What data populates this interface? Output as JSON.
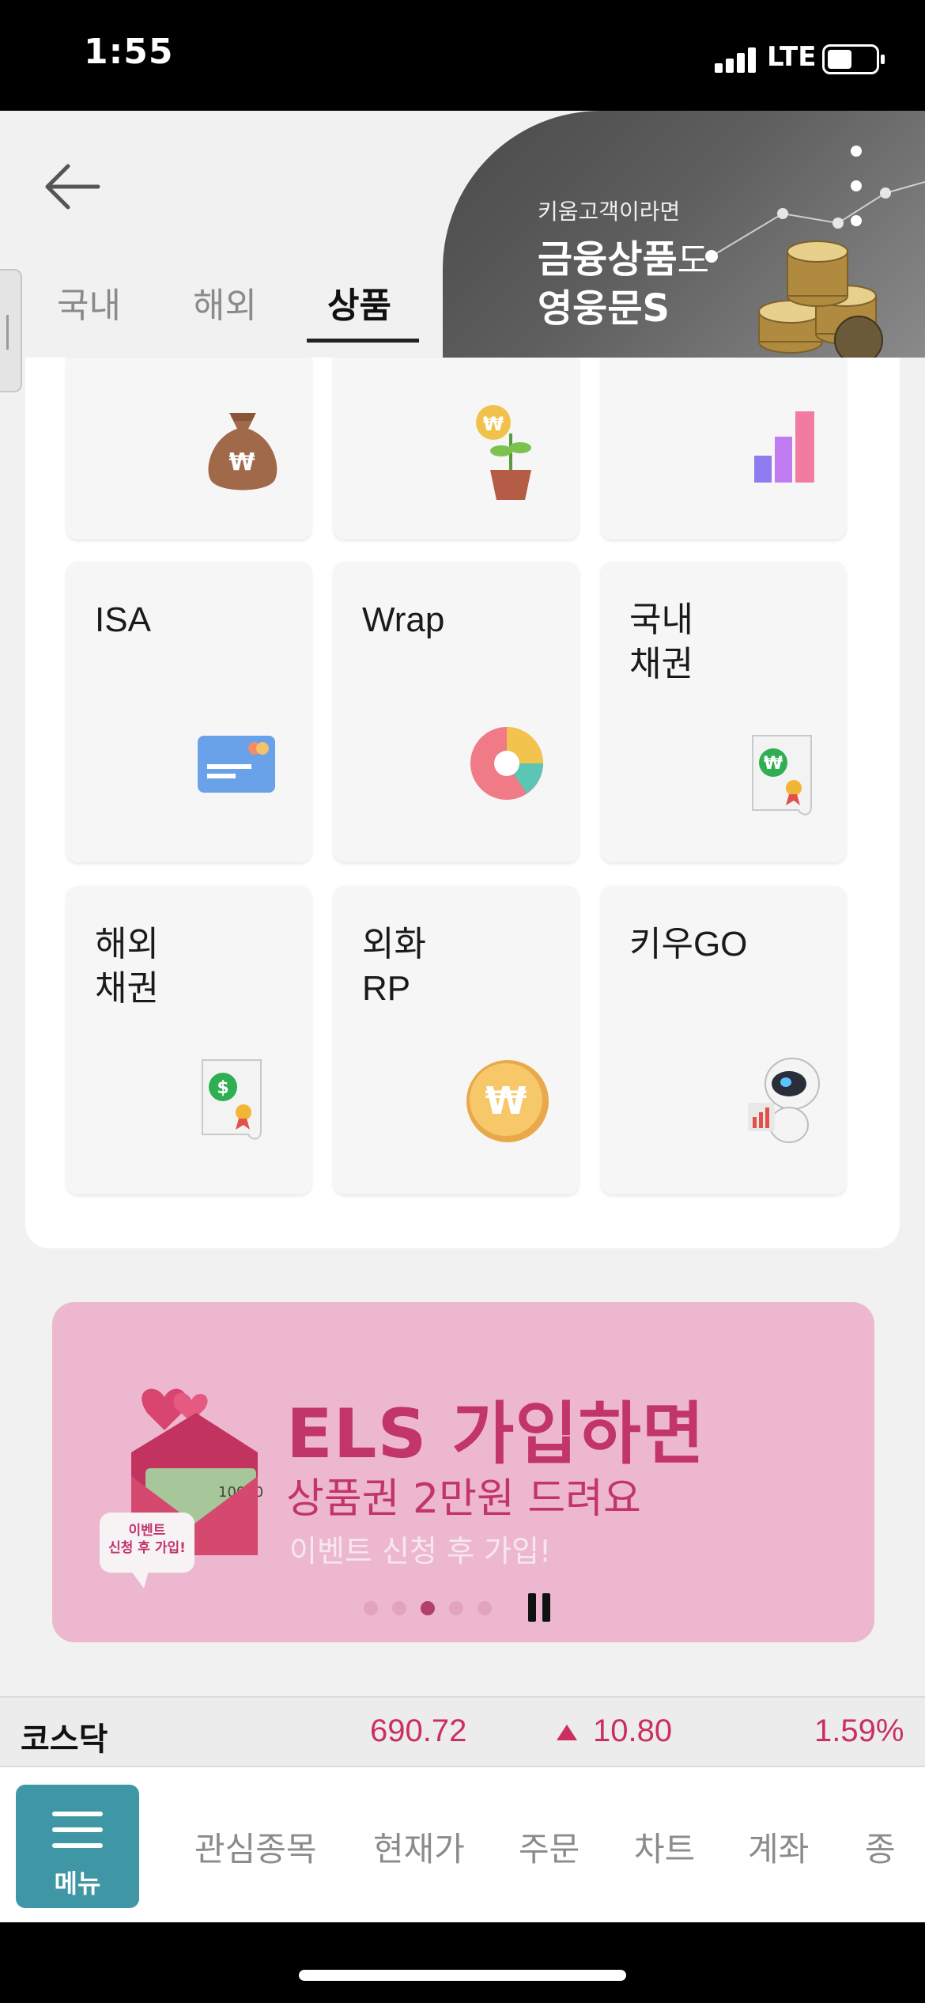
{
  "status": {
    "time": "1:55",
    "network": "LTE"
  },
  "tabs": [
    "국내",
    "해외",
    "상품"
  ],
  "hero": {
    "small": "키움고객이라면",
    "line1_bold": "금융상품",
    "line1_thin": "도",
    "line2": "영웅문S"
  },
  "tiles_row2": [
    {
      "label": "ISA",
      "icon": "credit-card-icon"
    },
    {
      "label": "Wrap",
      "icon": "pie-chart-icon"
    },
    {
      "label": "국내\n채권",
      "icon": "won-certificate-icon"
    }
  ],
  "tiles_row3": [
    {
      "label": "해외\n채권",
      "icon": "dollar-certificate-icon"
    },
    {
      "label": "외화\nRP",
      "icon": "won-coin-icon"
    },
    {
      "label": "키우GO",
      "icon": "robot-icon"
    }
  ],
  "tiles_row1_icons": [
    "money-bag-icon",
    "money-plant-icon",
    "bar-chart-icon"
  ],
  "banner": {
    "title": "ELS 가입하면",
    "subtitle": "상품권 2만원 드려요",
    "note": "이벤트 신청 후 가입!",
    "bubble": "이벤트\n신청 후 가입!",
    "card_number": "10000",
    "page_count": 5,
    "active_page": 3
  },
  "ticker": {
    "name": "코스닥",
    "price": "690.72",
    "change": "10.80",
    "rate": "1.59%"
  },
  "bottom_nav": {
    "menu_label": "메뉴",
    "items": [
      "관심종목",
      "현재가",
      "주문",
      "차트",
      "계좌",
      "종"
    ]
  },
  "colors": {
    "accent": "#3f97a6",
    "up": "#cc2f5f",
    "banner_bg": "#edb8cf",
    "banner_text": "#c1356b"
  }
}
